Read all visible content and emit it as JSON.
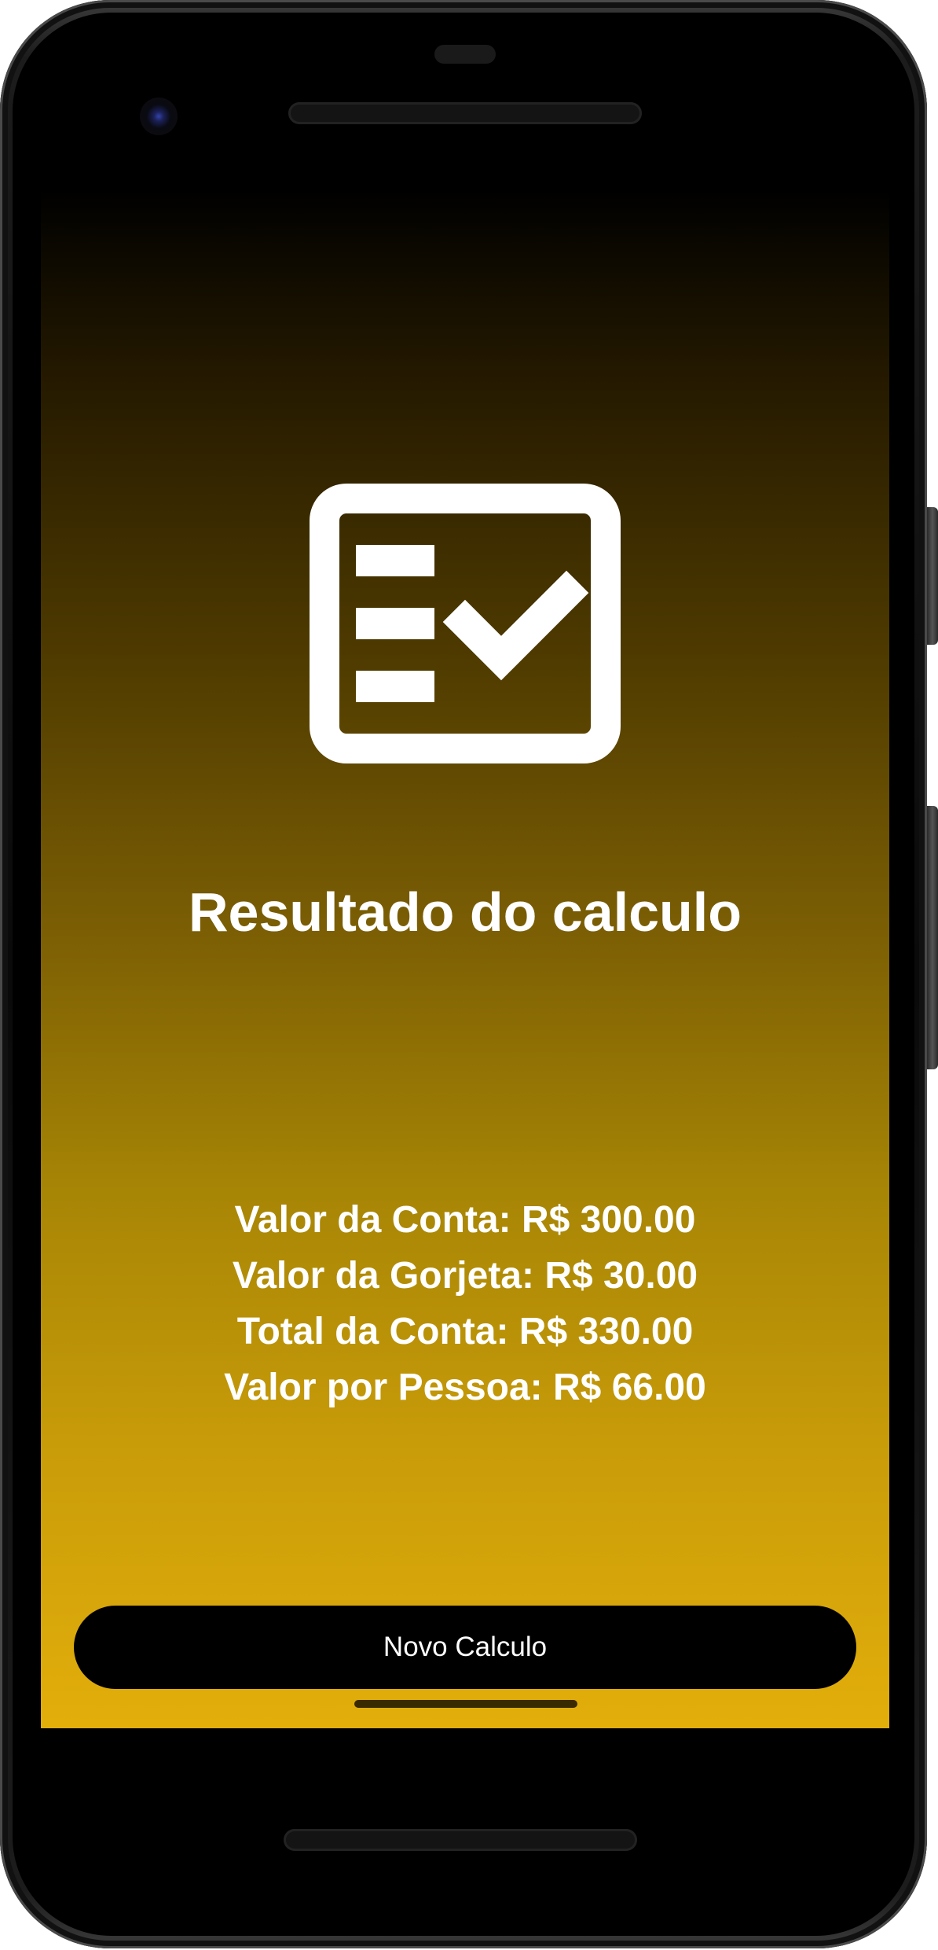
{
  "app": {
    "title": "Resultado do calculo"
  },
  "results": {
    "lines": [
      "Valor da Conta: R$ 300.00",
      "Valor da Gorjeta: R$ 30.00",
      "Total da Conta: R$ 330.00",
      "Valor por Pessoa: R$ 66.00"
    ]
  },
  "actions": {
    "new_calc_label": "Novo Calculo"
  },
  "icons": {
    "header_icon": "checklist-icon"
  },
  "colors": {
    "gradient_top": "#000000",
    "gradient_bottom": "#e2ae0a",
    "button_bg": "#000000",
    "text": "#ffffff"
  }
}
